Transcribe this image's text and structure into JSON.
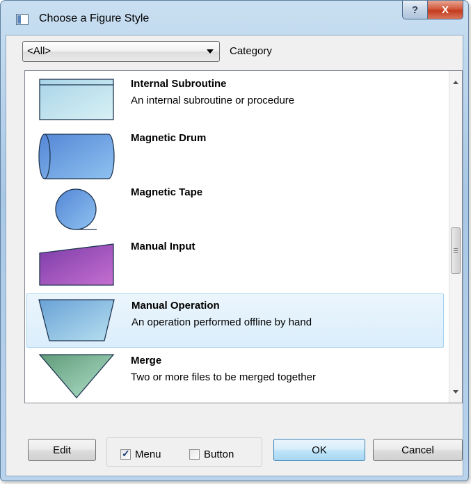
{
  "window": {
    "title": "Choose a Figure Style",
    "help_label": "?",
    "close_label": "X"
  },
  "category": {
    "selected": "<All>",
    "label": "Category"
  },
  "items": [
    {
      "name": "Internal Subroutine",
      "description": "An internal subroutine or procedure",
      "selected": false
    },
    {
      "name": "Magnetic Drum",
      "description": "",
      "selected": false
    },
    {
      "name": "Magnetic Tape",
      "description": "",
      "selected": false
    },
    {
      "name": "Manual Input",
      "description": "",
      "selected": false
    },
    {
      "name": "Manual Operation",
      "description": "An operation performed offline by hand",
      "selected": true
    },
    {
      "name": "Merge",
      "description": "Two or more files to be merged together",
      "selected": false
    }
  ],
  "footer": {
    "edit_label": "Edit",
    "menu_label": "Menu",
    "menu_checked": true,
    "button_label": "Button",
    "button_checked": false,
    "ok_label": "OK",
    "cancel_label": "Cancel"
  },
  "colors": {
    "selection_bg": "#dbeefb",
    "selection_border": "#a7d3f1",
    "close_red": "#c33b1d"
  }
}
